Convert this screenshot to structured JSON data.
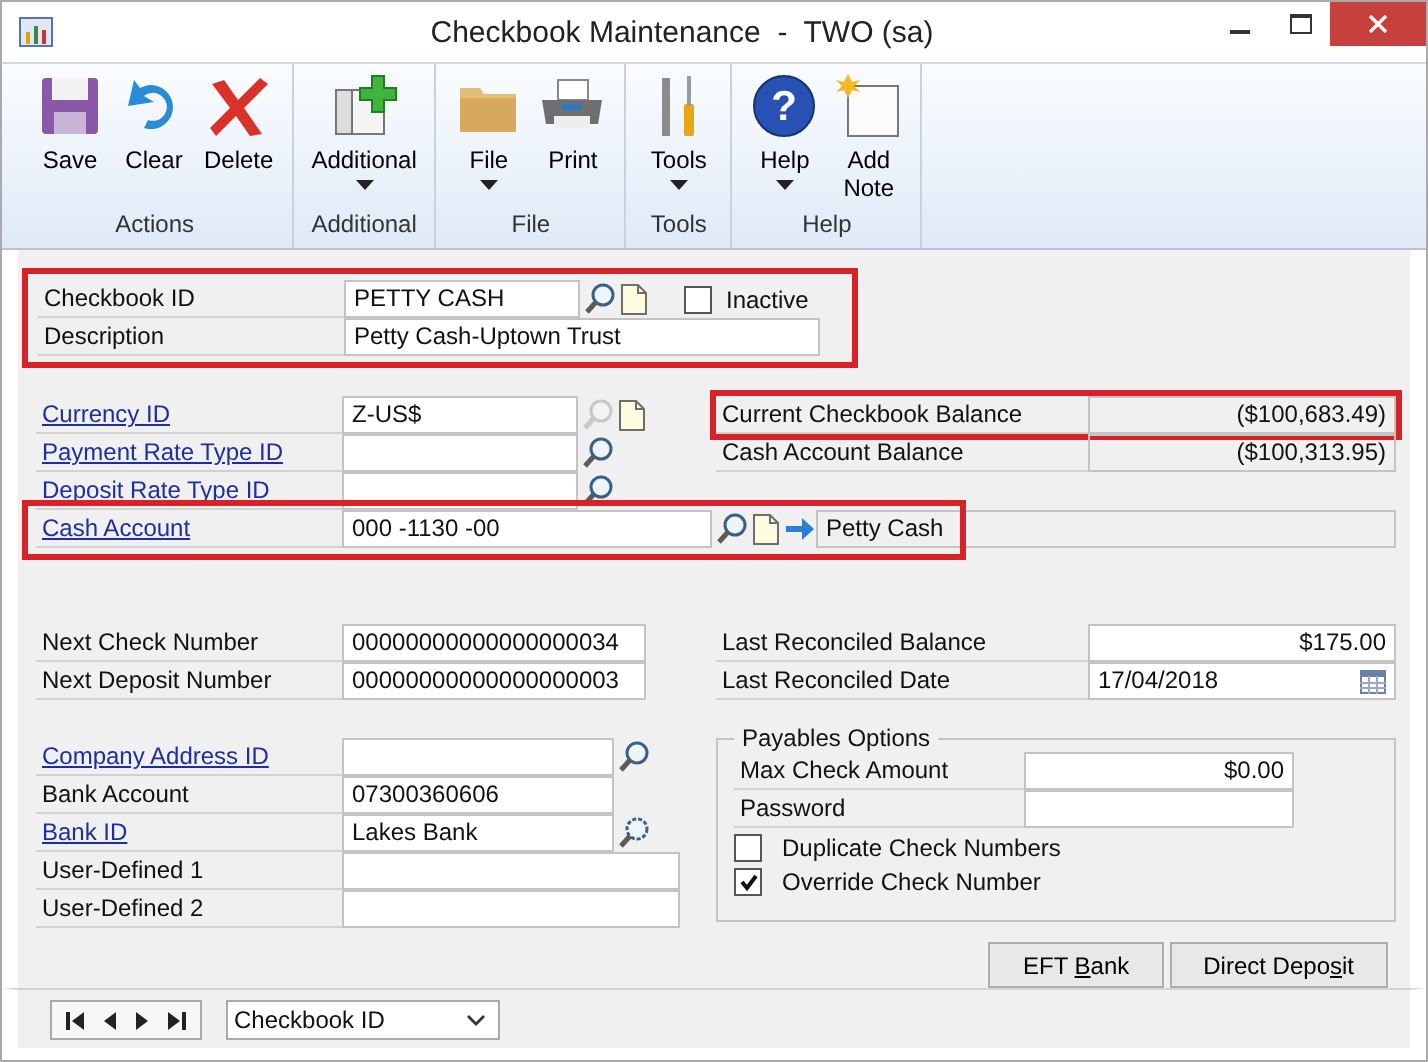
{
  "window": {
    "title": "Checkbook Maintenance  -  TWO (sa)"
  },
  "ribbon": [
    {
      "label": "Actions",
      "buttons": [
        {
          "label": "Save",
          "kind": "save",
          "dropdown": false
        },
        {
          "label": "Clear",
          "kind": "clear",
          "dropdown": false
        },
        {
          "label": "Delete",
          "kind": "delete",
          "dropdown": false
        }
      ]
    },
    {
      "label": "Additional",
      "buttons": [
        {
          "label": "Additional",
          "kind": "additional",
          "dropdown": true
        }
      ]
    },
    {
      "label": "File",
      "buttons": [
        {
          "label": "File",
          "kind": "file",
          "dropdown": true
        },
        {
          "label": "Print",
          "kind": "print",
          "dropdown": false
        }
      ]
    },
    {
      "label": "Tools",
      "buttons": [
        {
          "label": "Tools",
          "kind": "tools",
          "dropdown": true
        }
      ]
    },
    {
      "label": "Help",
      "buttons": [
        {
          "label": "Help",
          "kind": "help",
          "icon_text": "?",
          "dropdown": true
        },
        {
          "label": "Add Note",
          "kind": "note",
          "dropdown": false
        }
      ]
    }
  ],
  "header": {
    "highlighted": true,
    "fields": [
      {
        "label": "Checkbook ID",
        "link": false,
        "value": "PETTY CASH",
        "tools": [
          {
            "kind": "lookup",
            "disabled": false
          },
          {
            "kind": "note"
          }
        ]
      },
      {
        "label": "Description",
        "link": false,
        "value": "Petty Cash-Uptown Trust"
      }
    ]
  },
  "inactive": {
    "label": "Inactive",
    "checked": false
  },
  "currency_fields": [
    {
      "label": "Currency ID",
      "link": true,
      "value": "Z-US$",
      "tools": [
        {
          "kind": "lookup",
          "disabled": true
        },
        {
          "kind": "note"
        }
      ]
    },
    {
      "label": "Payment Rate Type ID",
      "link": true,
      "tools": [
        {
          "kind": "lookup",
          "disabled": false
        }
      ]
    },
    {
      "label": "Deposit Rate Type ID",
      "link": true,
      "tools": [
        {
          "kind": "lookup",
          "disabled": false
        }
      ]
    }
  ],
  "balances": [
    {
      "label": "Current Checkbook Balance",
      "value": "($100,683.49)",
      "highlighted": true
    },
    {
      "label": "Cash Account Balance",
      "value": "($100,313.95)",
      "highlighted": false
    }
  ],
  "cash_account": {
    "label": "Cash Account",
    "link": true,
    "value": "000 -1130 -00",
    "description": "Petty Cash",
    "highlighted": true,
    "tools": [
      {
        "kind": "lookup",
        "disabled": false
      },
      {
        "kind": "note"
      },
      {
        "kind": "goto"
      }
    ]
  },
  "numbers": [
    {
      "label": "Next Check Number",
      "value": "00000000000000000034"
    },
    {
      "label": "Next Deposit Number",
      "value": "00000000000000000003"
    }
  ],
  "reconcile": [
    {
      "label": "Last Reconciled Balance",
      "value": "$175.00",
      "calendar": false
    },
    {
      "label": "Last Reconciled Date",
      "value": "17/04/2018",
      "calendar": true
    }
  ],
  "bank_fields": [
    {
      "label": "Company Address ID",
      "link": true,
      "tools": [
        {
          "kind": "lookup",
          "disabled": false
        }
      ]
    },
    {
      "label": "Bank Account",
      "link": false,
      "value": "07300360606"
    },
    {
      "label": "Bank ID",
      "link": true,
      "value": "Lakes Bank",
      "tools": [
        {
          "kind": "bank_lookup"
        }
      ]
    },
    {
      "label": "User-Defined 1",
      "link": false
    },
    {
      "label": "User-Defined 2",
      "link": false
    }
  ],
  "payables_options": {
    "title": "Payables Options",
    "fields": [
      {
        "label": "Max Check Amount",
        "value": "$0.00"
      },
      {
        "label": "Password"
      }
    ],
    "checkboxes": [
      {
        "label": "Duplicate Check Numbers",
        "checked": false
      },
      {
        "label": "Override Check Number",
        "checked": true
      }
    ]
  },
  "buttons": [
    {
      "before": "EFT ",
      "key": "B",
      "after": "ank"
    },
    {
      "before": "Direct Depo",
      "key": "s",
      "after": "it"
    }
  ],
  "navigation": {
    "browse_by": "Checkbook ID"
  }
}
